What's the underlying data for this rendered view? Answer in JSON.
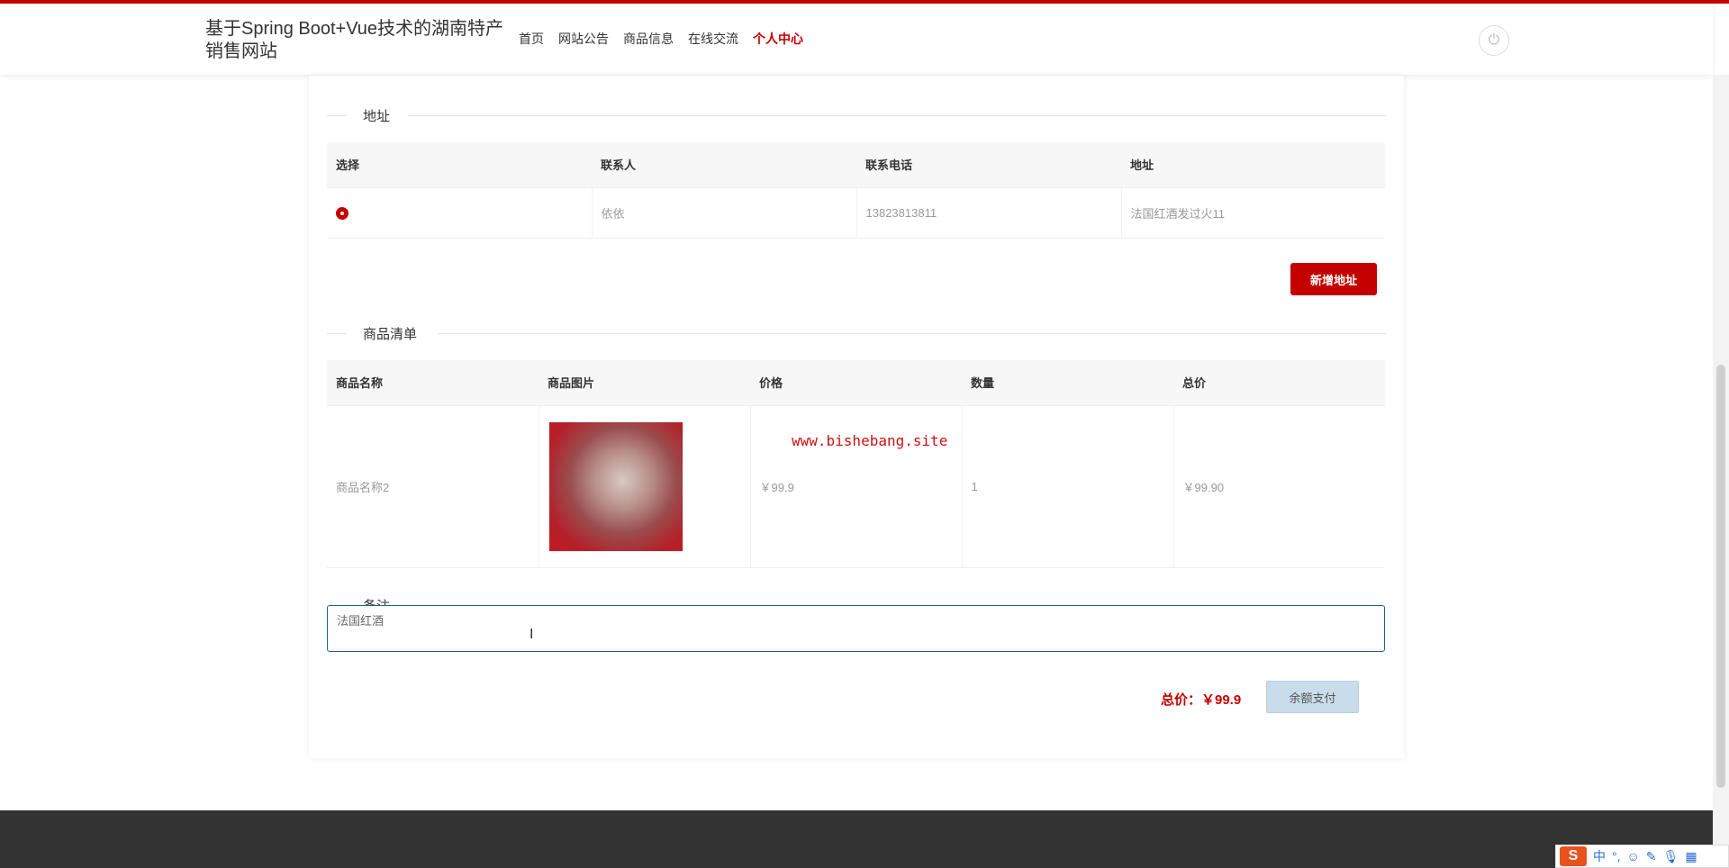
{
  "header": {
    "title": "基于Spring Boot+Vue技术的湖南特产销售网站",
    "nav": [
      {
        "label": "首页"
      },
      {
        "label": "网站公告"
      },
      {
        "label": "商品信息"
      },
      {
        "label": "在线交流"
      },
      {
        "label": "个人中心"
      }
    ],
    "power_icon": "power-icon"
  },
  "address_section": {
    "title": "地址",
    "columns": [
      "选择",
      "联系人",
      "联系电话",
      "地址"
    ],
    "rows": [
      {
        "contact": "依依",
        "phone": "13823813811",
        "address": "法国红酒发过火11"
      }
    ],
    "add_button": "新增地址"
  },
  "goods_section": {
    "title": "商品清单",
    "columns": [
      "商品名称",
      "商品图片",
      "价格",
      "数量",
      "总价"
    ],
    "rows": [
      {
        "name": "商品名称2",
        "price": "￥99.9",
        "quantity": "1",
        "total": "￥99.90"
      }
    ]
  },
  "watermark": "www.bishebang.site",
  "remark": {
    "label": "备注",
    "value": "法国红酒"
  },
  "summary": {
    "total_label": "总价：￥99.9",
    "pay_button": "余额支付"
  },
  "ime": {
    "logo": "S",
    "mode": "中",
    "punct": "°,"
  },
  "colors": {
    "accent": "#c40000",
    "footer": "#333333"
  }
}
